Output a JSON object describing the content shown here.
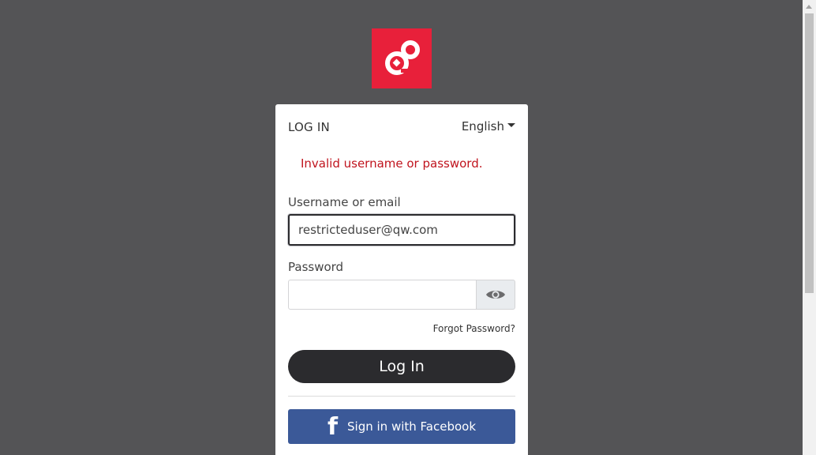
{
  "logo": {
    "icon": "qw-logo-icon",
    "color": "#e8203a"
  },
  "login": {
    "title": "LOG IN",
    "language": "English",
    "error": "Invalid username or password.",
    "username_label": "Username or email",
    "username_value": "restricteduser@qw.com",
    "password_label": "Password",
    "password_value": "",
    "forgot": "Forgot Password?",
    "login_button": "Log In",
    "facebook_button": "Sign in with Facebook"
  },
  "colors": {
    "background": "#545456",
    "error": "#c0141e",
    "primary_button": "#2b2b2e",
    "facebook": "#3b5998"
  }
}
